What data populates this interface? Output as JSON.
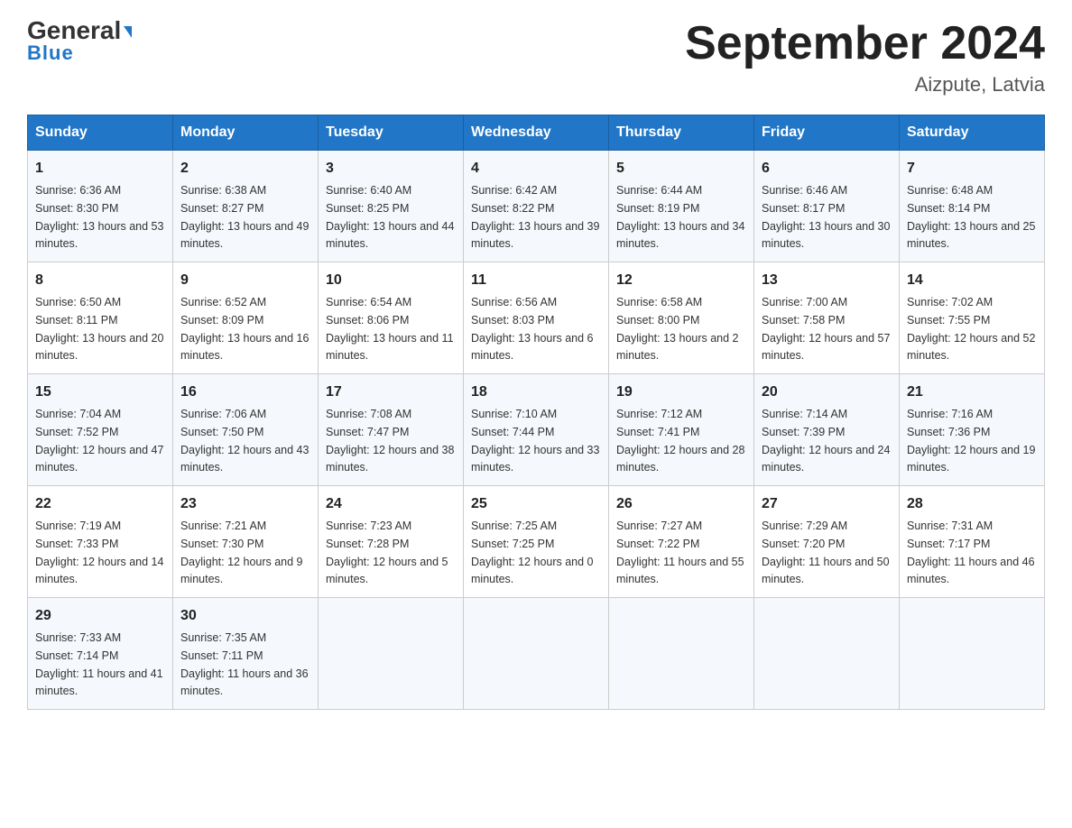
{
  "header": {
    "logo_general": "General",
    "logo_blue": "Blue",
    "month_title": "September 2024",
    "location": "Aizpute, Latvia"
  },
  "days_of_week": [
    "Sunday",
    "Monday",
    "Tuesday",
    "Wednesday",
    "Thursday",
    "Friday",
    "Saturday"
  ],
  "weeks": [
    [
      {
        "day": "1",
        "sunrise": "6:36 AM",
        "sunset": "8:30 PM",
        "daylight": "13 hours and 53 minutes."
      },
      {
        "day": "2",
        "sunrise": "6:38 AM",
        "sunset": "8:27 PM",
        "daylight": "13 hours and 49 minutes."
      },
      {
        "day": "3",
        "sunrise": "6:40 AM",
        "sunset": "8:25 PM",
        "daylight": "13 hours and 44 minutes."
      },
      {
        "day": "4",
        "sunrise": "6:42 AM",
        "sunset": "8:22 PM",
        "daylight": "13 hours and 39 minutes."
      },
      {
        "day": "5",
        "sunrise": "6:44 AM",
        "sunset": "8:19 PM",
        "daylight": "13 hours and 34 minutes."
      },
      {
        "day": "6",
        "sunrise": "6:46 AM",
        "sunset": "8:17 PM",
        "daylight": "13 hours and 30 minutes."
      },
      {
        "day": "7",
        "sunrise": "6:48 AM",
        "sunset": "8:14 PM",
        "daylight": "13 hours and 25 minutes."
      }
    ],
    [
      {
        "day": "8",
        "sunrise": "6:50 AM",
        "sunset": "8:11 PM",
        "daylight": "13 hours and 20 minutes."
      },
      {
        "day": "9",
        "sunrise": "6:52 AM",
        "sunset": "8:09 PM",
        "daylight": "13 hours and 16 minutes."
      },
      {
        "day": "10",
        "sunrise": "6:54 AM",
        "sunset": "8:06 PM",
        "daylight": "13 hours and 11 minutes."
      },
      {
        "day": "11",
        "sunrise": "6:56 AM",
        "sunset": "8:03 PM",
        "daylight": "13 hours and 6 minutes."
      },
      {
        "day": "12",
        "sunrise": "6:58 AM",
        "sunset": "8:00 PM",
        "daylight": "13 hours and 2 minutes."
      },
      {
        "day": "13",
        "sunrise": "7:00 AM",
        "sunset": "7:58 PM",
        "daylight": "12 hours and 57 minutes."
      },
      {
        "day": "14",
        "sunrise": "7:02 AM",
        "sunset": "7:55 PM",
        "daylight": "12 hours and 52 minutes."
      }
    ],
    [
      {
        "day": "15",
        "sunrise": "7:04 AM",
        "sunset": "7:52 PM",
        "daylight": "12 hours and 47 minutes."
      },
      {
        "day": "16",
        "sunrise": "7:06 AM",
        "sunset": "7:50 PM",
        "daylight": "12 hours and 43 minutes."
      },
      {
        "day": "17",
        "sunrise": "7:08 AM",
        "sunset": "7:47 PM",
        "daylight": "12 hours and 38 minutes."
      },
      {
        "day": "18",
        "sunrise": "7:10 AM",
        "sunset": "7:44 PM",
        "daylight": "12 hours and 33 minutes."
      },
      {
        "day": "19",
        "sunrise": "7:12 AM",
        "sunset": "7:41 PM",
        "daylight": "12 hours and 28 minutes."
      },
      {
        "day": "20",
        "sunrise": "7:14 AM",
        "sunset": "7:39 PM",
        "daylight": "12 hours and 24 minutes."
      },
      {
        "day": "21",
        "sunrise": "7:16 AM",
        "sunset": "7:36 PM",
        "daylight": "12 hours and 19 minutes."
      }
    ],
    [
      {
        "day": "22",
        "sunrise": "7:19 AM",
        "sunset": "7:33 PM",
        "daylight": "12 hours and 14 minutes."
      },
      {
        "day": "23",
        "sunrise": "7:21 AM",
        "sunset": "7:30 PM",
        "daylight": "12 hours and 9 minutes."
      },
      {
        "day": "24",
        "sunrise": "7:23 AM",
        "sunset": "7:28 PM",
        "daylight": "12 hours and 5 minutes."
      },
      {
        "day": "25",
        "sunrise": "7:25 AM",
        "sunset": "7:25 PM",
        "daylight": "12 hours and 0 minutes."
      },
      {
        "day": "26",
        "sunrise": "7:27 AM",
        "sunset": "7:22 PM",
        "daylight": "11 hours and 55 minutes."
      },
      {
        "day": "27",
        "sunrise": "7:29 AM",
        "sunset": "7:20 PM",
        "daylight": "11 hours and 50 minutes."
      },
      {
        "day": "28",
        "sunrise": "7:31 AM",
        "sunset": "7:17 PM",
        "daylight": "11 hours and 46 minutes."
      }
    ],
    [
      {
        "day": "29",
        "sunrise": "7:33 AM",
        "sunset": "7:14 PM",
        "daylight": "11 hours and 41 minutes."
      },
      {
        "day": "30",
        "sunrise": "7:35 AM",
        "sunset": "7:11 PM",
        "daylight": "11 hours and 36 minutes."
      },
      null,
      null,
      null,
      null,
      null
    ]
  ],
  "labels": {
    "sunrise": "Sunrise:",
    "sunset": "Sunset:",
    "daylight": "Daylight:"
  }
}
